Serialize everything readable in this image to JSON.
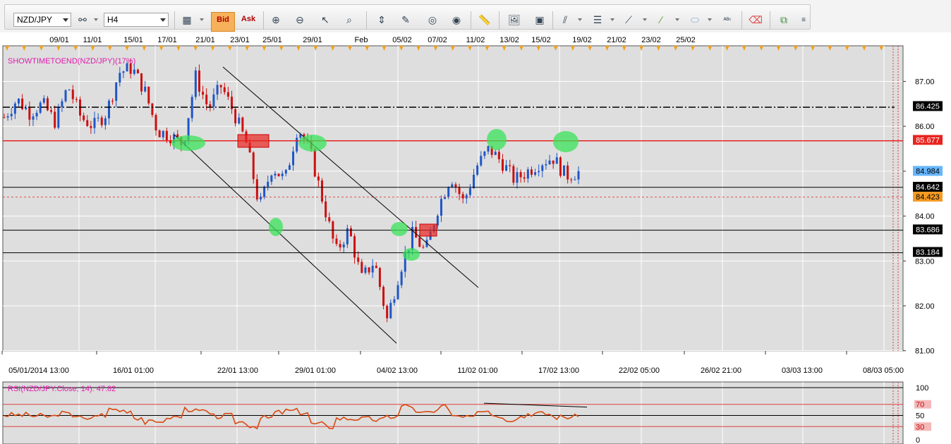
{
  "toolbar": {
    "symbol": "NZD/JPY",
    "timeframe": "H4",
    "bid_label": "Bid",
    "ask_label": "Ask",
    "icons": [
      "link-icon",
      "bar-chart-icon",
      "crosshair-icon",
      "zoom-in-icon",
      "zoom-out-icon",
      "cursor-icon",
      "zoom-area-icon",
      "fit-icon",
      "edit-icon",
      "eye-icon",
      "globe-icon",
      "ruler-icon",
      "picture-icon",
      "screenshot-icon",
      "fork-icon",
      "lines-icon",
      "fan-icon",
      "pencil-line-icon",
      "ellipse-icon",
      "text-abc-icon",
      "eraser-icon",
      "layers-icon",
      "more-icon"
    ]
  },
  "price_panel": {
    "indicator_label": "SHOWTIMETOEND(NZD/JPY)(17%)",
    "top_dates": [
      "09/01",
      "11/01",
      "15/01",
      "17/01",
      "21/01",
      "23/01",
      "25/01",
      "29/01",
      "Feb",
      "05/02",
      "07/02",
      "11/02",
      "13/02",
      "15/02",
      "19/02",
      "21/02",
      "23/02",
      "25/02"
    ],
    "bottom_dates": [
      "05/01/2014 13:00",
      "16/01 01:00",
      "22/01 13:00",
      "29/01 01:00",
      "04/02 13:00",
      "11/02 01:00",
      "17/02 13:00",
      "22/02 05:00",
      "26/02 21:00",
      "03/03 13:00",
      "08/03 05:00"
    ],
    "y_ticks": [
      "87.00",
      "86.00",
      "85.00",
      "84.00",
      "83.00",
      "82.00",
      "81.00"
    ],
    "price_tags": [
      {
        "value": "86.425",
        "bg": "#000000",
        "fg": "#ffffff"
      },
      {
        "value": "85.677",
        "bg": "#e8231f",
        "fg": "#ffffff"
      },
      {
        "value": "84.984",
        "bg": "#66b6ff",
        "fg": "#000000"
      },
      {
        "value": "84.642",
        "bg": "#000000",
        "fg": "#ffffff"
      },
      {
        "value": "84.423",
        "bg": "#f59a23",
        "fg": "#000000"
      },
      {
        "value": "83.686",
        "bg": "#000000",
        "fg": "#ffffff"
      },
      {
        "value": "83.184",
        "bg": "#000000",
        "fg": "#ffffff"
      }
    ]
  },
  "rsi_panel": {
    "label": "RSI(NZD/JPY.Close, 14): 47.82",
    "levels": [
      "100",
      "70",
      "50",
      "30",
      "0"
    ]
  },
  "colors": {
    "chart_bg": "#dedede",
    "grid": "#ffffff",
    "bull": "#1f56c6",
    "bear": "#cc1010",
    "resistance": "#e8231f",
    "highlight": "#39e35a",
    "rsi_line": "#d84a12",
    "indicator_text": "#e01cae"
  },
  "chart_data": {
    "type": "candlestick",
    "symbol": "NZD/JPY",
    "timeframe": "H4",
    "ylim": [
      81.0,
      87.5
    ],
    "key_levels": [
      86.425,
      85.677,
      84.984,
      84.642,
      84.423,
      83.686,
      83.184
    ],
    "approx_close_path": [
      86.2,
      86.6,
      86.3,
      86.5,
      86.1,
      86.9,
      86.2,
      86.0,
      86.3,
      87.2,
      87.3,
      86.8,
      85.9,
      85.8,
      85.6,
      87.1,
      86.4,
      86.9,
      86.3,
      85.6,
      84.2,
      85.1,
      84.8,
      86.0,
      85.4,
      84.3,
      83.2,
      83.7,
      82.6,
      83.0,
      81.7,
      82.8,
      83.6,
      83.2,
      84.2,
      84.9,
      84.3,
      85.1,
      85.5,
      85.2,
      84.8,
      85.0,
      85.2,
      85.3,
      84.9,
      84.98
    ],
    "rsi": {
      "period": 14,
      "last": 47.82,
      "levels": [
        30,
        50,
        70
      ]
    }
  }
}
